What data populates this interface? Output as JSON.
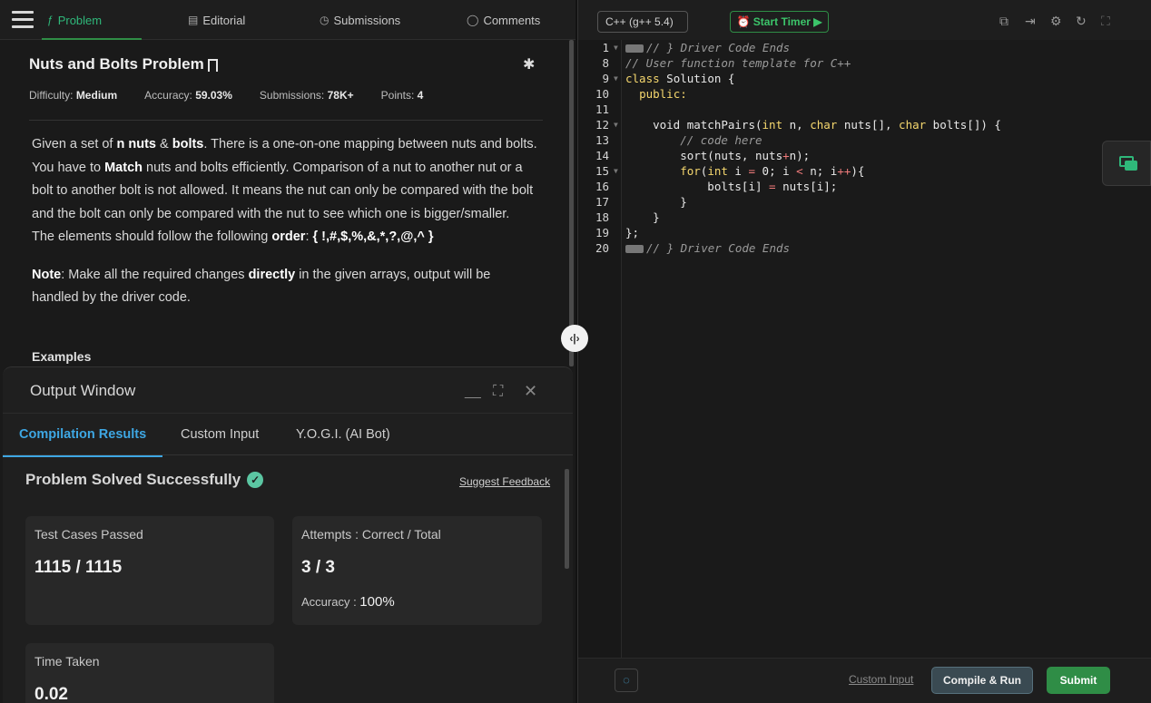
{
  "nav": {
    "tabs": [
      {
        "label": "Problem",
        "icon": "code-icon"
      },
      {
        "label": "Editorial",
        "icon": "document-icon"
      },
      {
        "label": "Submissions",
        "icon": "clock-icon"
      },
      {
        "label": "Comments",
        "icon": "chat-icon"
      }
    ],
    "active_tab": "Problem"
  },
  "problem": {
    "title": "Nuts and Bolts Problem",
    "difficulty_label": "Difficulty:",
    "difficulty": "Medium",
    "accuracy_label": "Accuracy:",
    "accuracy": "59.03%",
    "submissions_label": "Submissions:",
    "submissions": "78K+",
    "points_label": "Points:",
    "points": "4",
    "desc": {
      "p1a": "Given a set of ",
      "p1b": "n nuts",
      "p1c": " & ",
      "p1d": "bolts",
      "p1e": ". There is a one-on-one mapping between nuts and bolts. You have to ",
      "p1f": "Match",
      "p1g": " nuts and bolts efficiently. Comparison of a nut to another nut or a bolt to another bolt is not allowed. It means the nut can only be compared with the bolt and the bolt can only be compared with the nut to see which one is bigger/smaller.",
      "p2a": "The elements should follow the following ",
      "p2b": "order",
      "p2c": ": ",
      "p2d": "{ !,#,$,%,&,*,?,@,^ }",
      "p3a": "Note",
      "p3b": ": Make all the required changes ",
      "p3c": "directly",
      "p3d": " in the given arrays, output will be handled by the driver code."
    },
    "examples_heading": "Examples"
  },
  "output": {
    "title": "Output Window",
    "tabs": [
      "Compilation Results",
      "Custom Input",
      "Y.O.G.I. (AI Bot)"
    ],
    "status": "Problem Solved Successfully",
    "feedback": "Suggest Feedback",
    "test_cases_label": "Test Cases Passed",
    "test_cases_value": "1115 / 1115",
    "attempts_label": "Attempts : Correct / Total",
    "attempts_value": "3 / 3",
    "accuracy_label": "Accuracy : ",
    "accuracy_value": "100%",
    "time_label": "Time Taken",
    "time_value": "0.02"
  },
  "editor": {
    "language": "C++ (g++ 5.4)",
    "timer_label": "Start Timer",
    "lines": [
      {
        "n": "1",
        "fold": true
      },
      {
        "n": "8",
        "fold": false
      },
      {
        "n": "9",
        "fold": true
      },
      {
        "n": "10",
        "fold": false
      },
      {
        "n": "11",
        "fold": false
      },
      {
        "n": "12",
        "fold": true
      },
      {
        "n": "13",
        "fold": false
      },
      {
        "n": "14",
        "fold": false
      },
      {
        "n": "15",
        "fold": true
      },
      {
        "n": "16",
        "fold": false
      },
      {
        "n": "17",
        "fold": false
      },
      {
        "n": "18",
        "fold": false
      },
      {
        "n": "19",
        "fold": false
      },
      {
        "n": "20",
        "fold": false
      }
    ],
    "code": {
      "l1": "// } Driver Code Ends",
      "l8": "// User function template for C++",
      "l9a": "class",
      "l9b": " Solution {",
      "l10a": "  ",
      "l10b": "public:",
      "l12a": "    void matchPairs(",
      "l12b": "int",
      "l12c": " n, ",
      "l12d": "char",
      "l12e": " nuts[], ",
      "l12f": "char",
      "l12g": " bolts[]) {",
      "l13": "        // code here",
      "l14a": "        sort(nuts, nuts",
      "l14b": "+",
      "l14c": "n);",
      "l15a": "        ",
      "l15b": "for",
      "l15c": "(",
      "l15d": "int",
      "l15e": " i ",
      "l15f": "=",
      "l15g": " 0; i ",
      "l15h": "<",
      "l15i": " n; i",
      "l15j": "++",
      "l15k": "){",
      "l16a": "            bolts[i] ",
      "l16b": "=",
      "l16c": " nuts[i];",
      "l17": "        }",
      "l18": "    }",
      "l19": "};",
      "l20": "// } Driver Code Ends"
    },
    "custom_input": "Custom Input",
    "compile_run": "Compile & Run",
    "submit": "Submit"
  }
}
